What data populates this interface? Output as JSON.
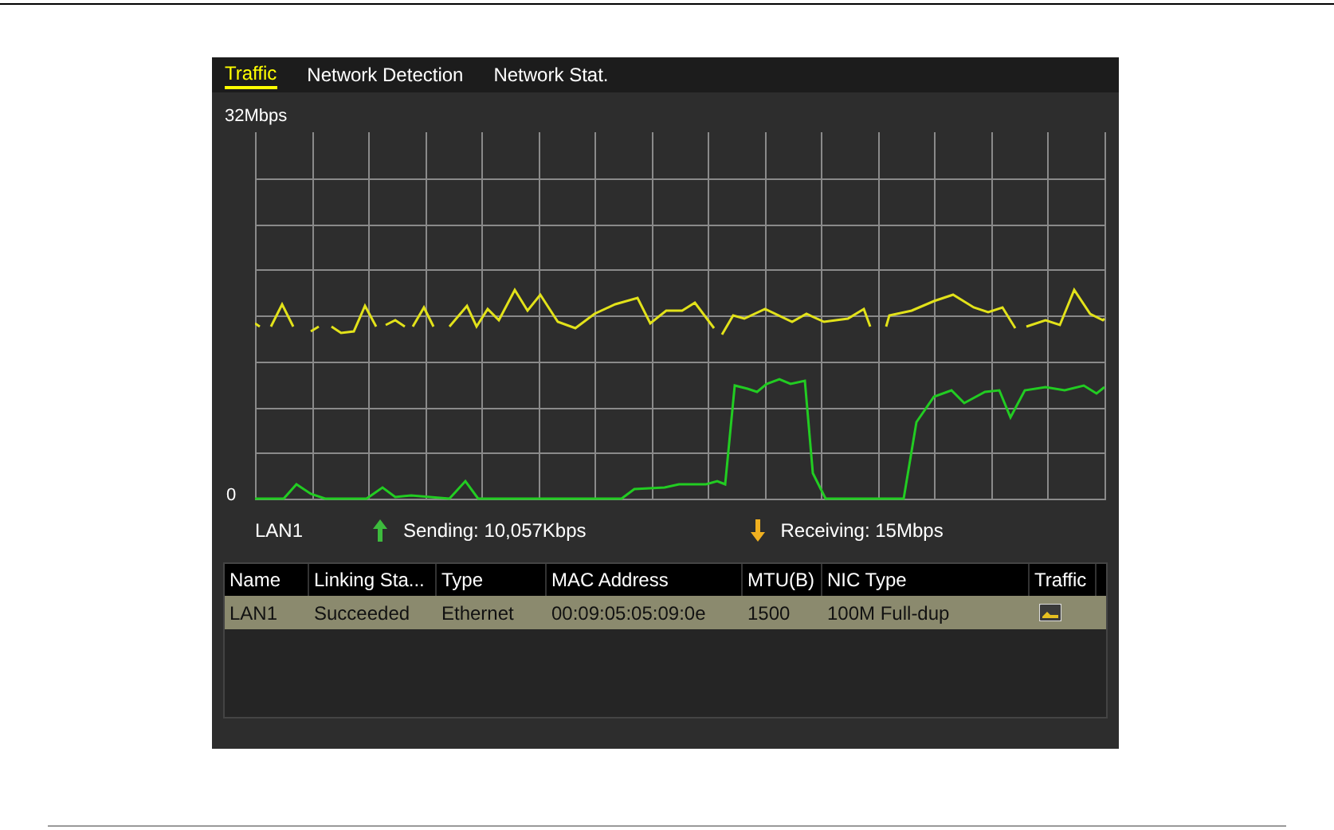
{
  "tabs": [
    {
      "label": "Traffic",
      "selected": true
    },
    {
      "label": "Network Detection",
      "selected": false
    },
    {
      "label": "Network Stat.",
      "selected": false
    }
  ],
  "graph": {
    "max_label": "32Mbps",
    "zero_label": "0"
  },
  "legend": {
    "interface": "LAN1",
    "sending": "Sending: 10,057Kbps",
    "receiving": "Receiving: 15Mbps"
  },
  "table": {
    "columns": [
      "Name",
      "Linking Sta...",
      "Type",
      "MAC Address",
      "MTU(B)",
      "NIC Type",
      "Traffic"
    ],
    "rows": [
      {
        "cells": [
          "LAN1",
          "Succeeded",
          "Ethernet",
          "00:09:05:05:09:0e",
          "1500",
          "100M Full-dup"
        ],
        "selected": true
      }
    ]
  }
}
